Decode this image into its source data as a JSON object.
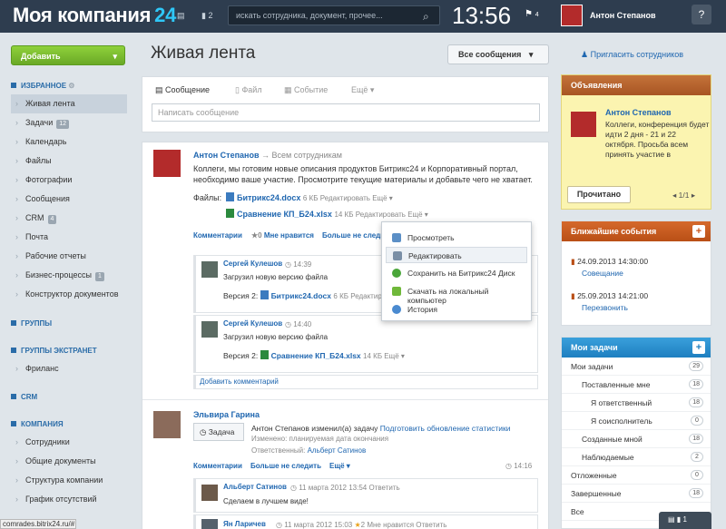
{
  "header": {
    "logo_name": "Моя компания",
    "logo_num": "24",
    "msg_count": "2",
    "search_placeholder": "искать сотрудника, документ, прочее...",
    "time": "13:56",
    "flag_count": "4",
    "user_name": "Антон Степанов",
    "help": "?"
  },
  "sidebar": {
    "add_button": "Добавить",
    "fav_section": "ИЗБРАННОЕ",
    "items": [
      {
        "label": "Живая лента"
      },
      {
        "label": "Задачи",
        "count": "12"
      },
      {
        "label": "Календарь"
      },
      {
        "label": "Файлы"
      },
      {
        "label": "Фотографии"
      },
      {
        "label": "Сообщения"
      },
      {
        "label": "CRM",
        "count": "4"
      },
      {
        "label": "Почта"
      },
      {
        "label": "Рабочие отчеты"
      },
      {
        "label": "Бизнес-процессы",
        "count": "1"
      },
      {
        "label": "Конструктор документов"
      }
    ],
    "groups_section": "ГРУППЫ",
    "extranet_section": "ГРУППЫ ЭКСТРАНЕТ",
    "extranet_item": "Фриланс",
    "crm_section": "CRM",
    "company_section": "КОМПАНИЯ",
    "company_items": [
      "Сотрудники",
      "Общие документы",
      "Структура компании",
      "График отсутствий"
    ]
  },
  "main": {
    "title": "Живая лента",
    "filter": "Все сообщения",
    "tabs": [
      "Сообщение",
      "Файл",
      "Событие",
      "Ещё"
    ],
    "message_placeholder": "Написать сообщение"
  },
  "post1": {
    "author": "Антон Степанов",
    "audience": "Всем сотрудникам",
    "text1": "Коллеги, мы готовим новые описания продуктов Битрикс24 и Корпоративный портал,",
    "text2": "необходимо ваше участие. Просмотрите текущие материалы и добавьте чего не хватает.",
    "files_label": "Файлы:",
    "file1": "Битрикс24.docx",
    "file1_size": "6 КБ",
    "file2": "Сравнение КП_Б24.xlsx",
    "file2_size": "14 КБ",
    "edit_label": "Редактировать",
    "more": "Ещё",
    "comments": "Комментарии",
    "likes": "0",
    "like_label": "Мне нравится",
    "unfollow": "Больше не следить",
    "comment1": {
      "author": "Сергей Кулешов",
      "time": "14:39",
      "text": "Загрузил новую версию файла",
      "version": "Версия 2:",
      "file": "Битрикс24.docx",
      "size": "6 КБ"
    },
    "comment2": {
      "author": "Сергей Кулешов",
      "time": "14:40",
      "text": "Загрузил новую версию файла",
      "version": "Версия 2:",
      "file": "Сравнение КП_Б24.xlsx",
      "size": "14 КБ"
    },
    "add_comment": "Добавить комментарий"
  },
  "menu": {
    "items": [
      "Просмотреть",
      "Редактировать",
      "Сохранить на Битрикс24 Диск",
      "Скачать на локальный компьютер",
      "История"
    ]
  },
  "post2": {
    "author": "Эльвира Гарина",
    "task_badge": "Задача",
    "text": "Антон Степанов изменил(а) задачу",
    "task_link": "Подготовить обновление статистики",
    "changed": "Изменено:  планируемая дата окончания",
    "responsible_label": "Ответственный:",
    "responsible": "Альберт Сатинов",
    "comments": "Комментарии",
    "unfollow": "Больше не следить",
    "more": "Ещё",
    "time": "14:16",
    "comment1": {
      "author": "Альберт Сатинов",
      "time": "11 марта 2012 13:54",
      "reply": "Ответить",
      "text": "Сделаем в лучшем виде!"
    },
    "comment2": {
      "author": "Ян Ларичев",
      "time": "11 марта 2012 15:03",
      "likes": "2",
      "like_label": "Мне нравится",
      "reply": "Ответить"
    }
  },
  "right": {
    "invite": "Пригласить сотрудников",
    "ann_title": "Объявления",
    "ann_author": "Антон Степанов",
    "ann_text1": "Коллеги, конференция будет",
    "ann_text2": "идти 2 дня - 21 и 22",
    "ann_text3": "октября.   Просьба всем",
    "ann_text4": "принять участие в",
    "ann_read": "Прочитано",
    "ann_pager": "1/1",
    "events_title": "Ближайшие события",
    "event1_date": "24.09.2013 14:30:00",
    "event1_name": "Совещание",
    "event2_date": "25.09.2013 14:21:00",
    "event2_name": "Перезвонить",
    "tasks_title": "Мои задачи",
    "tasks": [
      {
        "label": "Мои задачи",
        "count": "29"
      },
      {
        "label": "Поставленные мне",
        "count": "18"
      },
      {
        "label": "Я ответственный",
        "count": "18"
      },
      {
        "label": "Я соисполнитель",
        "count": "0"
      },
      {
        "label": "Созданные мной",
        "count": "18"
      },
      {
        "label": "Наблюдаемые",
        "count": "2"
      },
      {
        "label": "Отложенные",
        "count": "0"
      },
      {
        "label": "Завершенные",
        "count": "18"
      },
      {
        "label": "Все",
        "count": ""
      }
    ]
  },
  "status": {
    "url": "comrades.bitrix24.ru/#",
    "chat_count1": "",
    "chat_count2": "1"
  }
}
